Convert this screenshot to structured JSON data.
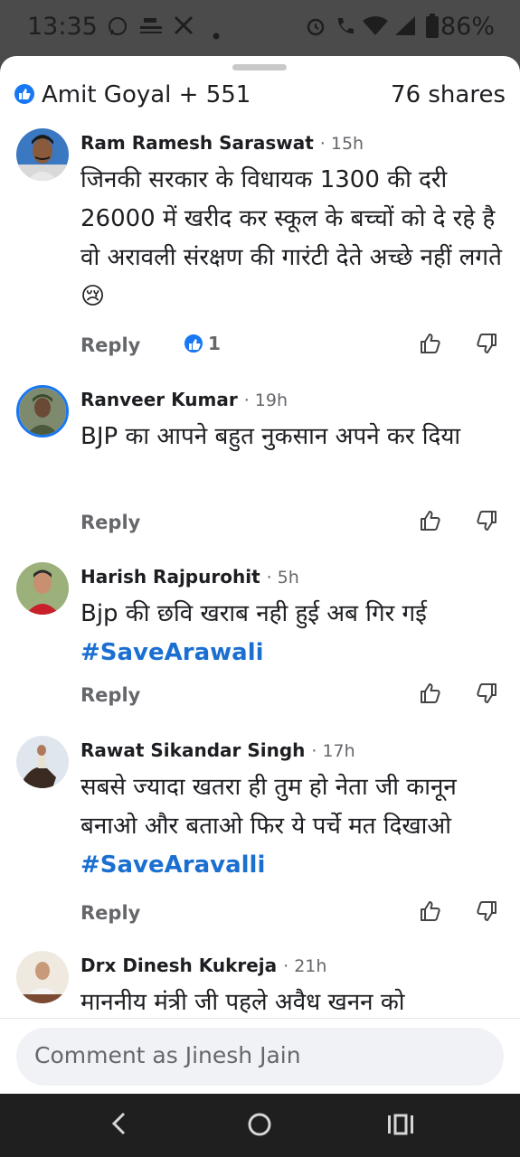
{
  "status_bar": {
    "time": "13:35",
    "battery": "86%",
    "icons": [
      "whatsapp-icon",
      "news-icon",
      "x-icon",
      "dot-icon",
      "alarm-icon",
      "wifi-call-icon",
      "wifi-icon",
      "signal-icon",
      "battery-icon"
    ]
  },
  "header": {
    "reactions": "Amit Goyal + 551",
    "shares": "76 shares"
  },
  "comments": [
    {
      "author": "Ram Ramesh Saraswat",
      "time": "· 15h",
      "text": "जिनकी सरकार के विधायक 1300 की दरी 26000 में खरीद कर स्कूल के बच्चों को दे रहे है वो अरावली संरक्षण की गारंटी देते अच्छे नहीं लगते 😢",
      "reply": "Reply",
      "reaction_count": "1"
    },
    {
      "author": "Ranveer Kumar",
      "time": "· 19h",
      "text": "BJP का आपने बहुत नुकसान अपने कर दिया",
      "reply": "Reply"
    },
    {
      "author": "Harish Rajpurohit",
      "time": "· 5h",
      "text": "Bjp की छवि खराब नही हुई अब गिर गई",
      "hashtag": "#SaveArawali",
      "reply": "Reply"
    },
    {
      "author": "Rawat Sikandar Singh",
      "time": "· 17h",
      "text": "सबसे ज्यादा खतरा ही तुम हो नेता जी कानून बनाओ और बताओ फिर ये पर्चे मत दिखाओ",
      "hashtag": "#SaveAravalli",
      "reply": "Reply"
    },
    {
      "author": "Drx Dinesh Kukreja",
      "time": "· 21h",
      "text": "माननीय मंत्री जी पहले अवैध खनन को"
    }
  ],
  "composer": {
    "placeholder": "Comment as Jinesh Jain"
  },
  "colors": {
    "accent": "#1877f2",
    "hashtag": "#1a6fd1",
    "muted": "#65676b"
  }
}
